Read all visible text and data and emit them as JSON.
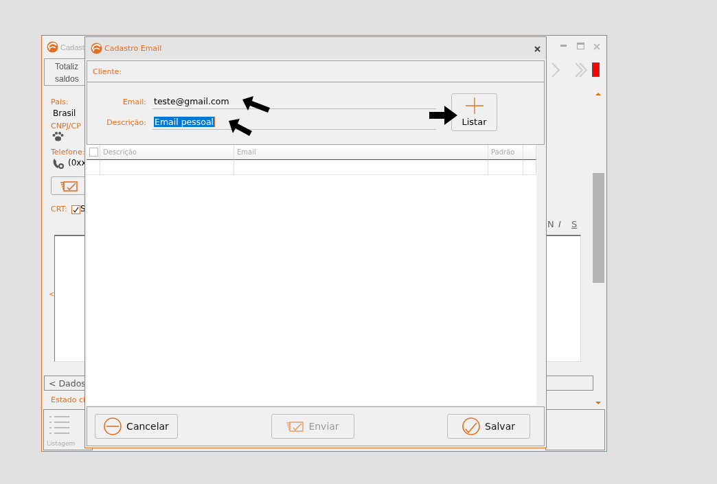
{
  "background_window": {
    "title": "Cadast",
    "totals_lines": [
      "Totaliz",
      "saldos"
    ],
    "pais_label": "Pais:",
    "pais_value": "Brasil",
    "cnpj_label": "CNPJ/CP",
    "phone_label": "Telefone:",
    "phone_value": "(0xx",
    "crt_label": "CRT:",
    "crt_checked": true,
    "crt_option": "S",
    "collapse_arrow": "<",
    "dados_button": "< Dados",
    "estado_label": "Estado ci",
    "list_label": "Listagem",
    "format_buttons": [
      "N",
      "I",
      "S"
    ]
  },
  "dialog": {
    "title": "Cadastro Email",
    "cliente_label": "Cliente:",
    "email_label": "Email:",
    "email_value": "teste@gmail.com",
    "descricao_label": "Descrição:",
    "descricao_value": "Email pessoal",
    "descricao_selected": true,
    "add_button": "Listar",
    "table": {
      "columns": [
        "Descrição",
        "Email",
        "Padrão"
      ],
      "select_all_checked": false
    },
    "buttons": [
      {
        "label": "Cancelar",
        "kind": "cancel",
        "disabled": false
      },
      {
        "label": "Enviar",
        "kind": "send",
        "disabled": true
      },
      {
        "label": "Salvar",
        "kind": "save",
        "disabled": false
      }
    ]
  }
}
